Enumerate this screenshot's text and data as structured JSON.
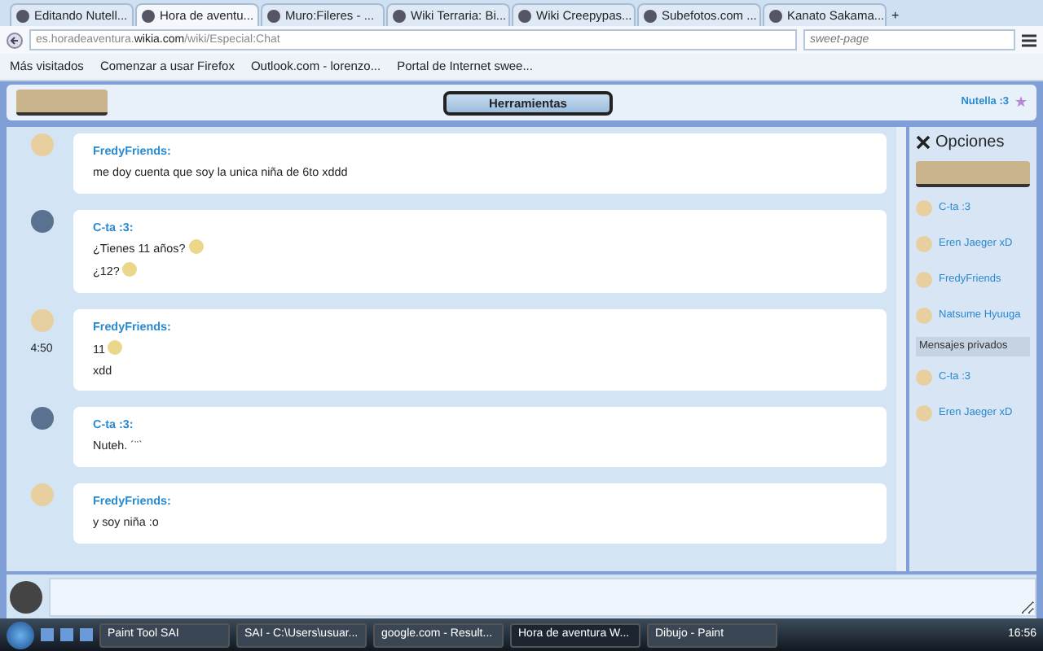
{
  "browser": {
    "tabs": [
      {
        "label": "Editando Nutell...",
        "selected": false
      },
      {
        "label": "Hora de aventu...",
        "selected": true
      },
      {
        "label": "Muro:Fileres - ...",
        "selected": false
      },
      {
        "label": "Wiki Terraria: Bi...",
        "selected": false
      },
      {
        "label": "Wiki Creepypas...",
        "selected": false
      },
      {
        "label": "Subefotos.com ...",
        "selected": false
      },
      {
        "label": "Kanato Sakama...",
        "selected": false
      }
    ],
    "new_tab": "+",
    "address": "es.horadeaventura.**wikia.com**/wiki/Especial:Chat",
    "search": {
      "placeholder": "sweet-page"
    },
    "bookmarks": [
      "Más visitados",
      "Comenzar a usar Firefox",
      "Outlook.com - lorenzo...",
      "Portal de Internet swee..."
    ]
  },
  "chat": {
    "menu_button": "Herramientas",
    "current_user": "Nutella :3",
    "messages": [
      {
        "user": "FredyFriends:",
        "lines": [
          {
            "text": "me doy cuenta que soy la unica niña de 6to xddd",
            "smiley": false
          }
        ]
      },
      {
        "user": "C-ta :3:",
        "lines": [
          {
            "text": "¿Tienes 11 años?",
            "smiley": true
          },
          {
            "text": "¿12?",
            "smiley": true
          }
        ]
      },
      {
        "user": "FredyFriends:",
        "time": "4:50",
        "lines": [
          {
            "text": "11",
            "smiley": true
          },
          {
            "text": "xdd",
            "smiley": false
          }
        ]
      },
      {
        "user": "C-ta :3:",
        "lines": [
          {
            "text": "Nuteh. ´¨`",
            "smiley": false
          }
        ]
      },
      {
        "user": "FredyFriends:",
        "lines": [
          {
            "text": "y soy niña :o",
            "smiley": false
          }
        ]
      }
    ],
    "sidebar": {
      "title": "Opciones",
      "users": [
        "C-ta :3",
        "Eren Jaeger xD",
        "FredyFriends",
        "Natsume Hyuuga"
      ],
      "private_heading": "Mensajes privados",
      "private_users": [
        "C-ta :3",
        "Eren Jaeger xD"
      ]
    }
  },
  "taskbar": {
    "items": [
      {
        "label": "Paint Tool SAI",
        "selected": false
      },
      {
        "label": "SAI - C:\\Users\\usuar...",
        "selected": false
      },
      {
        "label": "google.com - Result...",
        "selected": false
      },
      {
        "label": "Hora de aventura W...",
        "selected": true
      },
      {
        "label": "Dibujo - Paint",
        "selected": false
      }
    ],
    "clock": "16:56"
  }
}
